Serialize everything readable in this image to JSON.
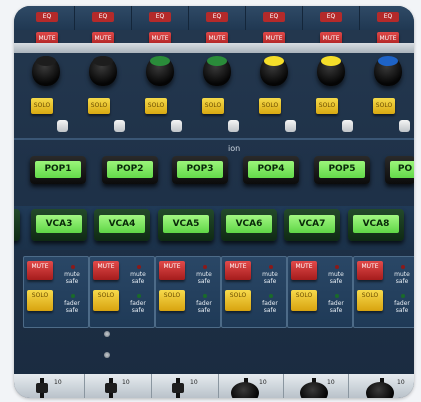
{
  "top_section": {
    "eq_label": "EQ",
    "mute_label": "MUTE",
    "solo_label": "SOLO",
    "knob_cap_colors": [
      "#1d1d1d",
      "#1d1d1d",
      "#2a8c3a",
      "#2a8c3a",
      "#f5de2a",
      "#f5de2a",
      "#1e63c6"
    ]
  },
  "panel_label": "ion",
  "pop_buttons": [
    "POP1",
    "POP2",
    "POP3",
    "POP4",
    "POP5",
    "PO"
  ],
  "vca_buttons": [
    "VCA3",
    "VCA4",
    "VCA5",
    "VCA6",
    "VCA7",
    "VCA8"
  ],
  "vca_panel": {
    "mute_label": "MUTE",
    "solo_label": "SOLO",
    "mute_safe_label": "mute safe",
    "fader_safe_label": "fader safe"
  },
  "fader_section": {
    "scale_label": "10"
  },
  "colors": {
    "panel_bg": "#1f3249",
    "lcd_green": "#6ee052",
    "mute_red": "#c02a2a",
    "solo_yellow": "#e8c21e"
  }
}
